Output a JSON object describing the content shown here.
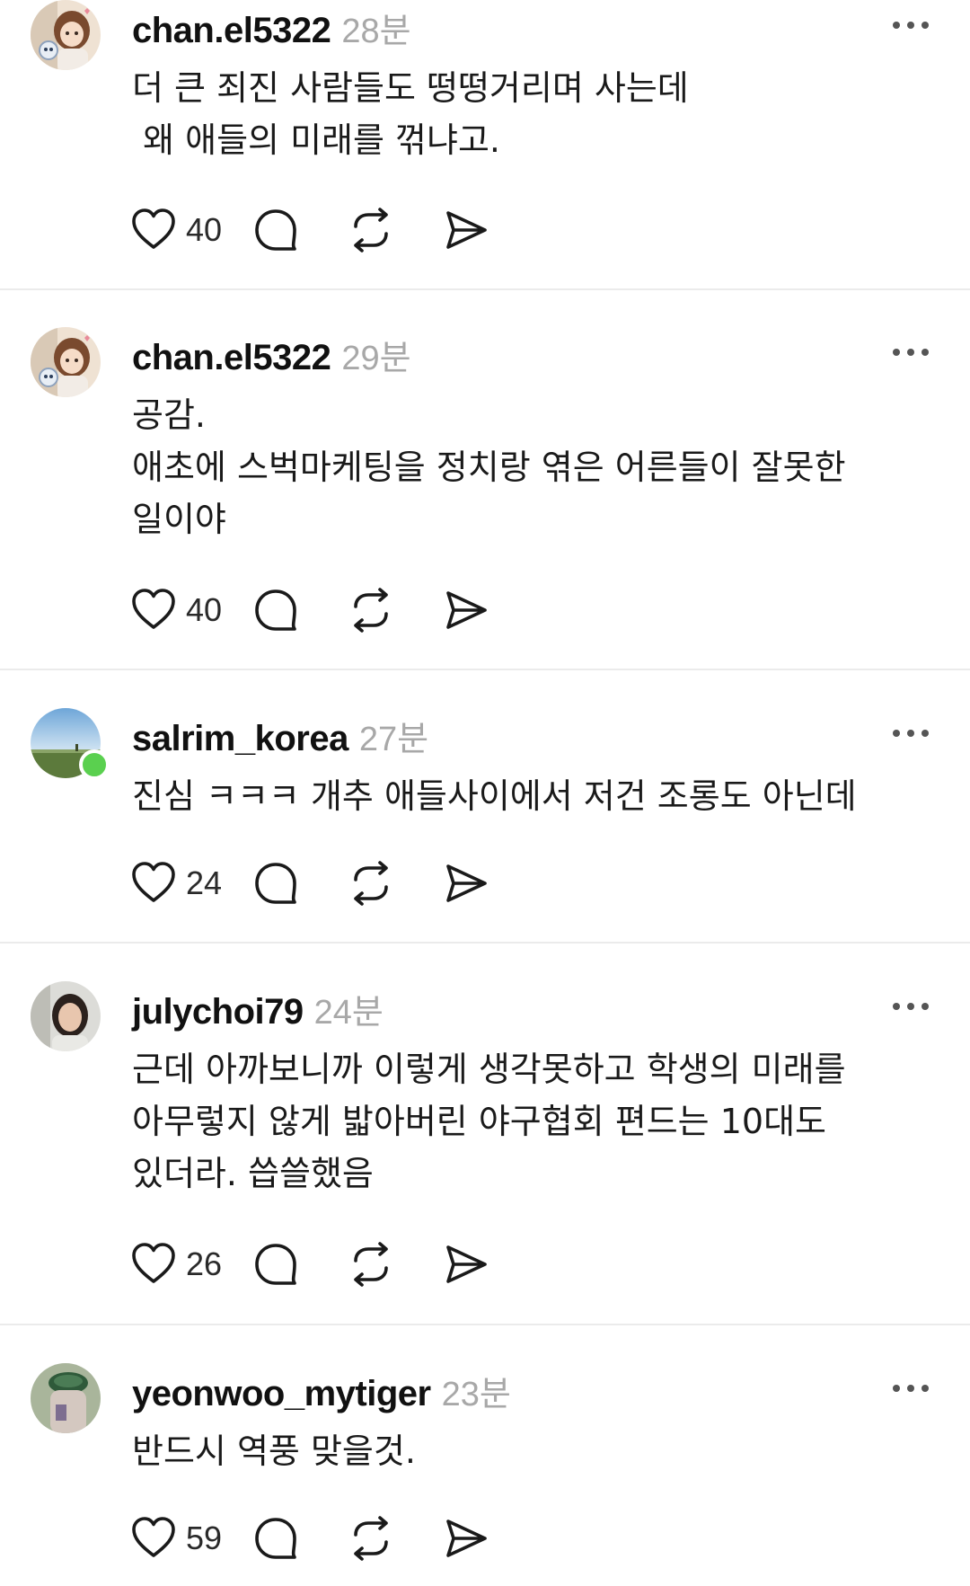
{
  "icons": {
    "like": "heart-icon",
    "reply": "speech-bubble-icon",
    "repost": "repost-icon",
    "share": "paper-plane-icon",
    "more": "more-dots-icon"
  },
  "colors": {
    "text": "#1a1a1a",
    "muted": "#a8a8a8",
    "divider": "#ebebeb",
    "online": "#5ad04f"
  },
  "comments": [
    {
      "username": "chan.el5322",
      "time": "28분",
      "text": "더 큰 죄진 사람들도 떵떵거리며 사는데\n 왜 애들의 미래를 꺾냐고.",
      "likes": "40"
    },
    {
      "username": "chan.el5322",
      "time": "29분",
      "text": "공감.\n애초에 스벅마케팅을 정치랑 엮은 어른들이 잘못한\n일이야",
      "likes": "40"
    },
    {
      "username": "salrim_korea",
      "time": "27분",
      "text": "진심 ㅋㅋㅋ 개추 애들사이에서 저건 조롱도 아닌데",
      "likes": "24",
      "online": true
    },
    {
      "username": "julychoi79",
      "time": "24분",
      "text": "근데 아까보니까 이렇게 생각못하고 학생의 미래를\n아무렇지 않게 밟아버린 야구협회 편드는 10대도\n있더라. 씁쓸했음",
      "likes": "26"
    },
    {
      "username": "yeonwoo_mytiger",
      "time": "23분",
      "text": "반드시 역풍 맞을것.",
      "likes": "59"
    }
  ]
}
